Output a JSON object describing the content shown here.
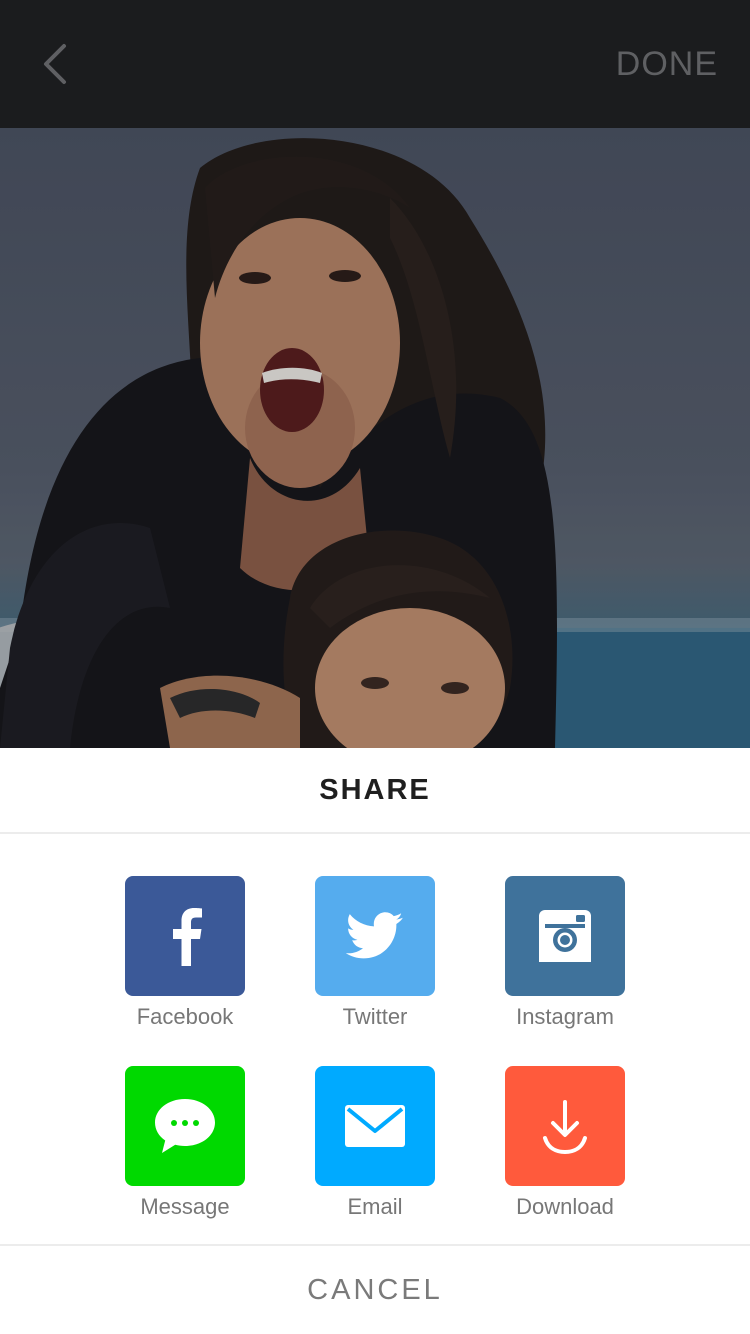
{
  "header": {
    "back_icon": "chevron-left-icon",
    "done_label": "DONE"
  },
  "photo": {
    "description_icon": "photo-image"
  },
  "share_sheet": {
    "title": "SHARE",
    "items": [
      {
        "label": "Facebook",
        "icon": "facebook-icon",
        "color": "#3b5998"
      },
      {
        "label": "Twitter",
        "icon": "twitter-icon",
        "color": "#55acee"
      },
      {
        "label": "Instagram",
        "icon": "instagram-icon",
        "color": "#3f729b"
      },
      {
        "label": "Message",
        "icon": "message-icon",
        "color": "#00d900"
      },
      {
        "label": "Email",
        "icon": "email-icon",
        "color": "#00aaff"
      },
      {
        "label": "Download",
        "icon": "download-icon",
        "color": "#ff5a3c"
      }
    ],
    "cancel_label": "CANCEL"
  }
}
